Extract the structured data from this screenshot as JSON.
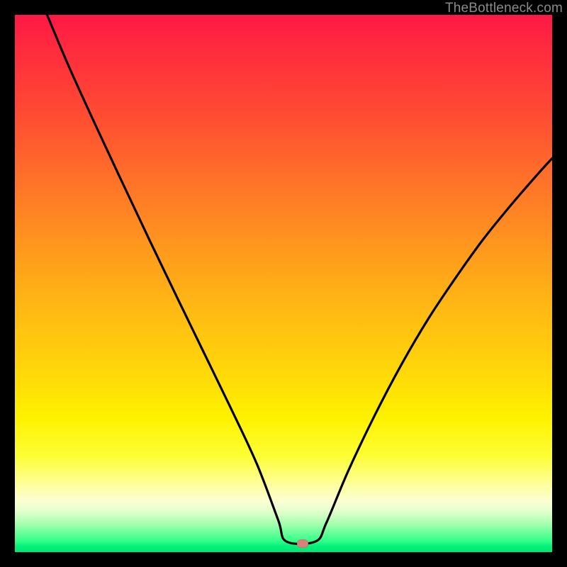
{
  "watermark": "TheBottleneck.com",
  "marker": {
    "x_frac": 0.535,
    "y_frac": 0.984,
    "color": "#d9807a"
  },
  "chart_data": {
    "type": "line",
    "title": "",
    "xlabel": "",
    "ylabel": "",
    "xlim": [
      0,
      1
    ],
    "ylim": [
      0,
      1
    ],
    "note": "Axes are unlabeled in the source image; values are normalized fractions of the plot area. The curve depicts a V-shaped bottleneck curve with its minimum near x≈0.53 touching the bottom (green) band; a small salmon marker sits at the minimum.",
    "series": [
      {
        "name": "bottleneck-curve",
        "x": [
          0.06,
          0.1,
          0.15,
          0.2,
          0.25,
          0.3,
          0.35,
          0.4,
          0.45,
          0.49,
          0.505,
          0.56,
          0.58,
          0.62,
          0.67,
          0.72,
          0.77,
          0.82,
          0.87,
          0.92,
          0.97,
          1.0
        ],
        "y": [
          1.0,
          0.905,
          0.795,
          0.688,
          0.582,
          0.478,
          0.375,
          0.272,
          0.165,
          0.06,
          0.02,
          0.02,
          0.055,
          0.15,
          0.255,
          0.35,
          0.435,
          0.51,
          0.58,
          0.642,
          0.7,
          0.733
        ]
      }
    ],
    "background_gradient": {
      "direction": "top-to-bottom",
      "stops": [
        {
          "pos": 0.0,
          "color": "#ff1846"
        },
        {
          "pos": 0.3,
          "color": "#ff6f2a"
        },
        {
          "pos": 0.66,
          "color": "#ffd60a"
        },
        {
          "pos": 0.88,
          "color": "#feffa8"
        },
        {
          "pos": 0.95,
          "color": "#9cffac"
        },
        {
          "pos": 1.0,
          "color": "#00e676"
        }
      ]
    }
  }
}
